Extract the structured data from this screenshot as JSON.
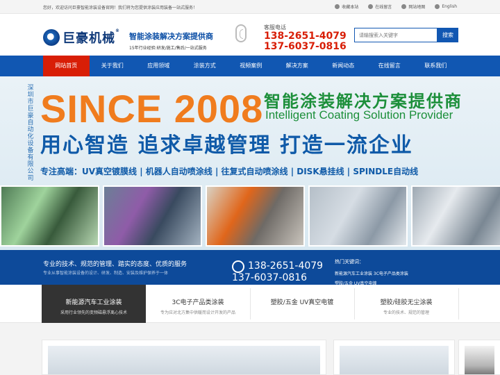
{
  "topbar": {
    "welcome": "您好，欢迎访问巨豪智能涂装设备官网！我们将为您提供涂装应用装备一站式服务！",
    "links": [
      {
        "icon": "star-icon",
        "label": "收藏本站"
      },
      {
        "icon": "message-icon",
        "label": "在线留言"
      },
      {
        "icon": "sitemap-icon",
        "label": "网站地图"
      },
      {
        "icon": "globe-icon",
        "label": "English"
      }
    ]
  },
  "header": {
    "logo_text": "巨豪机械",
    "logo_mark": "®",
    "slogan_main": "智能涂装解决方案提供商",
    "slogan_sub": "15年行业经验:研发/施工/售后/一站式服务",
    "hotline_label": "客服电话",
    "phone1": "138-2651-4079",
    "phone2": "137-6037-0816",
    "search_placeholder": "请输搜索入关键字",
    "search_button": "搜索"
  },
  "nav": [
    "网站首页",
    "关于我们",
    "应用领域",
    "涂装方式",
    "视频案例",
    "解决方案",
    "新闻动态",
    "在线留言",
    "联系我们"
  ],
  "banner": {
    "vertical_text": "深圳市巨豪自动化设备有限公司",
    "since": "SINCE 2008",
    "cn_title": "智能涂装解决方案提供商",
    "en_title": "Intelligent Coating Solution Provider",
    "big_slogan": "用心智造  追求卓越管理  打造一流企业",
    "focus": "专注高端：UV真空镀膜线 | 机器人自动喷涂线 | 往复式自动喷涂线 | DISK悬挂线 | SPINDLE自动线"
  },
  "band": {
    "line1": "专业的技术、规范的管理、踏实的态度、优质的服务",
    "line2": "专业从事智能涂装设备的设计、研发、制造、安装及维护保养于一体",
    "phone1": "138-2651-4079",
    "phone2": "137-6037-0816",
    "hot_title": "热门关键词：",
    "hot1": "新能源汽车工业涂装  3C电子产品类涂装",
    "hot2": "塑胶/五金 UV真空电镀"
  },
  "tabs": [
    {
      "title": "新能源汽车工业涂装",
      "desc": "采用行业领先的变频磁悬浮离心技术"
    },
    {
      "title": "3C电子产品类涂装",
      "desc": "专为应对北方集中供暖而设计开发的产品"
    },
    {
      "title": "塑胶/五金 UV真空电镀",
      "desc": ""
    },
    {
      "title": "塑胶/硅胶无尘涂装",
      "desc": "专业的技术、规范的管理"
    }
  ],
  "colors": {
    "nav_blue": "#1157b2",
    "accent_red": "#d81e06",
    "band_blue": "#0d4a9a",
    "since_orange": "#f07c1e",
    "title_green": "#1c8f3a"
  }
}
